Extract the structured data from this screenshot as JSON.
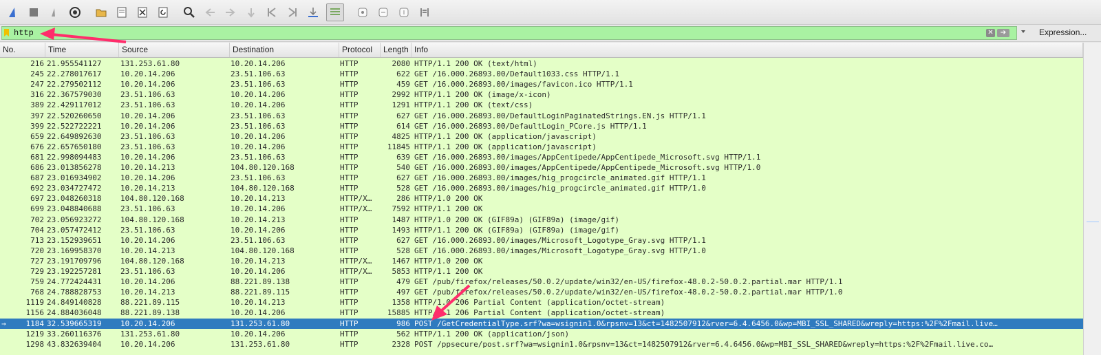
{
  "filter": {
    "value": "http",
    "clear_label": "✕",
    "apply_label": "➔",
    "expression_label": "Expression..."
  },
  "columns": [
    "No.",
    "Time",
    "Source",
    "Destination",
    "Protocol",
    "Length",
    "Info"
  ],
  "rows": [
    {
      "no": "216",
      "time": "21.955541127",
      "src": "131.253.61.80",
      "dst": "10.20.14.206",
      "proto": "HTTP",
      "len": "2080",
      "info": "HTTP/1.1 200 OK  (text/html)"
    },
    {
      "no": "245",
      "time": "22.278017617",
      "src": "10.20.14.206",
      "dst": "23.51.106.63",
      "proto": "HTTP",
      "len": "622",
      "info": "GET /16.000.26893.00/Default1033.css HTTP/1.1"
    },
    {
      "no": "247",
      "time": "22.279502112",
      "src": "10.20.14.206",
      "dst": "23.51.106.63",
      "proto": "HTTP",
      "len": "459",
      "info": "GET /16.000.26893.00/images/favicon.ico HTTP/1.1"
    },
    {
      "no": "316",
      "time": "22.367579030",
      "src": "23.51.106.63",
      "dst": "10.20.14.206",
      "proto": "HTTP",
      "len": "2992",
      "info": "HTTP/1.1 200 OK  (image/x-icon)"
    },
    {
      "no": "389",
      "time": "22.429117012",
      "src": "23.51.106.63",
      "dst": "10.20.14.206",
      "proto": "HTTP",
      "len": "1291",
      "info": "HTTP/1.1 200 OK  (text/css)"
    },
    {
      "no": "397",
      "time": "22.520260650",
      "src": "10.20.14.206",
      "dst": "23.51.106.63",
      "proto": "HTTP",
      "len": "627",
      "info": "GET /16.000.26893.00/DefaultLoginPaginatedStrings.EN.js HTTP/1.1"
    },
    {
      "no": "399",
      "time": "22.522722221",
      "src": "10.20.14.206",
      "dst": "23.51.106.63",
      "proto": "HTTP",
      "len": "614",
      "info": "GET /16.000.26893.00/DefaultLogin_PCore.js HTTP/1.1"
    },
    {
      "no": "659",
      "time": "22.649892630",
      "src": "23.51.106.63",
      "dst": "10.20.14.206",
      "proto": "HTTP",
      "len": "4825",
      "info": "HTTP/1.1 200 OK  (application/javascript)"
    },
    {
      "no": "676",
      "time": "22.657650180",
      "src": "23.51.106.63",
      "dst": "10.20.14.206",
      "proto": "HTTP",
      "len": "11845",
      "info": "HTTP/1.1 200 OK  (application/javascript)"
    },
    {
      "no": "681",
      "time": "22.998094483",
      "src": "10.20.14.206",
      "dst": "23.51.106.63",
      "proto": "HTTP",
      "len": "639",
      "info": "GET /16.000.26893.00/images/AppCentipede/AppCentipede_Microsoft.svg HTTP/1.1"
    },
    {
      "no": "686",
      "time": "23.013856278",
      "src": "10.20.14.213",
      "dst": "104.80.120.168",
      "proto": "HTTP",
      "len": "540",
      "info": "GET /16.000.26893.00/images/AppCentipede/AppCentipede_Microsoft.svg HTTP/1.0"
    },
    {
      "no": "687",
      "time": "23.016934902",
      "src": "10.20.14.206",
      "dst": "23.51.106.63",
      "proto": "HTTP",
      "len": "627",
      "info": "GET /16.000.26893.00/images/hig_progcircle_animated.gif HTTP/1.1"
    },
    {
      "no": "692",
      "time": "23.034727472",
      "src": "10.20.14.213",
      "dst": "104.80.120.168",
      "proto": "HTTP",
      "len": "528",
      "info": "GET /16.000.26893.00/images/hig_progcircle_animated.gif HTTP/1.0"
    },
    {
      "no": "697",
      "time": "23.048260318",
      "src": "104.80.120.168",
      "dst": "10.20.14.213",
      "proto": "HTTP/X…",
      "len": "286",
      "info": "HTTP/1.0 200 OK"
    },
    {
      "no": "699",
      "time": "23.048840688",
      "src": "23.51.106.63",
      "dst": "10.20.14.206",
      "proto": "HTTP/X…",
      "len": "7592",
      "info": "HTTP/1.1 200 OK"
    },
    {
      "no": "702",
      "time": "23.056923272",
      "src": "104.80.120.168",
      "dst": "10.20.14.213",
      "proto": "HTTP",
      "len": "1487",
      "info": "HTTP/1.0 200 OK  (GIF89a) (GIF89a) (image/gif)"
    },
    {
      "no": "704",
      "time": "23.057472412",
      "src": "23.51.106.63",
      "dst": "10.20.14.206",
      "proto": "HTTP",
      "len": "1493",
      "info": "HTTP/1.1 200 OK  (GIF89a) (GIF89a) (image/gif)"
    },
    {
      "no": "713",
      "time": "23.152939651",
      "src": "10.20.14.206",
      "dst": "23.51.106.63",
      "proto": "HTTP",
      "len": "627",
      "info": "GET /16.000.26893.00/images/Microsoft_Logotype_Gray.svg HTTP/1.1"
    },
    {
      "no": "720",
      "time": "23.169958370",
      "src": "10.20.14.213",
      "dst": "104.80.120.168",
      "proto": "HTTP",
      "len": "528",
      "info": "GET /16.000.26893.00/images/Microsoft_Logotype_Gray.svg HTTP/1.0"
    },
    {
      "no": "727",
      "time": "23.191709796",
      "src": "104.80.120.168",
      "dst": "10.20.14.213",
      "proto": "HTTP/X…",
      "len": "1467",
      "info": "HTTP/1.0 200 OK"
    },
    {
      "no": "729",
      "time": "23.192257281",
      "src": "23.51.106.63",
      "dst": "10.20.14.206",
      "proto": "HTTP/X…",
      "len": "5853",
      "info": "HTTP/1.1 200 OK"
    },
    {
      "no": "759",
      "time": "24.772424431",
      "src": "10.20.14.206",
      "dst": "88.221.89.138",
      "proto": "HTTP",
      "len": "479",
      "info": "GET /pub/firefox/releases/50.0.2/update/win32/en-US/firefox-48.0.2-50.0.2.partial.mar HTTP/1.1"
    },
    {
      "no": "768",
      "time": "24.788828753",
      "src": "10.20.14.213",
      "dst": "88.221.89.115",
      "proto": "HTTP",
      "len": "497",
      "info": "GET /pub/firefox/releases/50.0.2/update/win32/en-US/firefox-48.0.2-50.0.2.partial.mar HTTP/1.0"
    },
    {
      "no": "1119",
      "time": "24.849140828",
      "src": "88.221.89.115",
      "dst": "10.20.14.213",
      "proto": "HTTP",
      "len": "1358",
      "info": "HTTP/1.0 206 Partial Content  (application/octet-stream)"
    },
    {
      "no": "1156",
      "time": "24.884036048",
      "src": "88.221.89.138",
      "dst": "10.20.14.206",
      "proto": "HTTP",
      "len": "15885",
      "info": "HTTP/1.1 206 Partial Content  (application/octet-stream)"
    },
    {
      "no": "1184",
      "time": "32.539665319",
      "src": "10.20.14.206",
      "dst": "131.253.61.80",
      "proto": "HTTP",
      "len": "986",
      "info": "POST /GetCredentialType.srf?wa=wsignin1.0&rpsnv=13&ct=1482507912&rver=6.4.6456.0&wp=MBI_SSL_SHARED&wreply=https:%2F%2Fmail.live…",
      "selected": true
    },
    {
      "no": "1219",
      "time": "33.260116376",
      "src": "131.253.61.80",
      "dst": "10.20.14.206",
      "proto": "HTTP",
      "len": "562",
      "info": "HTTP/1.1 200 OK  (application/json)"
    },
    {
      "no": "1298",
      "time": "43.832639404",
      "src": "10.20.14.206",
      "dst": "131.253.61.80",
      "proto": "HTTP",
      "len": "2328",
      "info": "POST /ppsecure/post.srf?wa=wsignin1.0&rpsnv=13&ct=1482507912&rver=6.4.6456.0&wp=MBI_SSL_SHARED&wreply=https:%2F%2Fmail.live.co…"
    }
  ],
  "colors": {
    "row_bg": "#e4ffc7",
    "selected_bg": "#2f7bbf",
    "filter_bg": "#a9f2a2",
    "annotation_arrow": "#ff2d6b"
  }
}
